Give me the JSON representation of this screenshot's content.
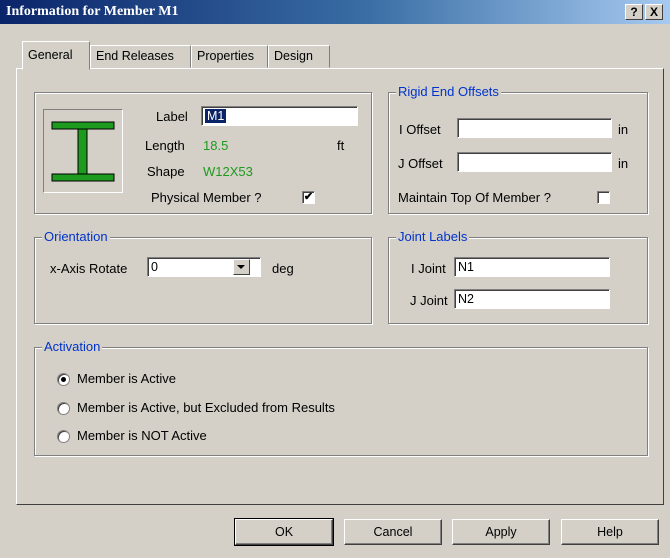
{
  "window": {
    "title": "Information for Member M1",
    "help_btn": "?",
    "close_btn": "X"
  },
  "tabs": [
    "General",
    "End Releases",
    "Properties",
    "Design"
  ],
  "member": {
    "label_caption": "Label",
    "label_value": "M1",
    "length_caption": "Length",
    "length_value": "18.5",
    "length_unit": "ft",
    "shape_caption": "Shape",
    "shape_value": "W12X53",
    "physical_caption": "Physical Member ?"
  },
  "rigid": {
    "title": "Rigid End Offsets",
    "i_caption": "I Offset",
    "i_value": "",
    "i_unit": "in",
    "j_caption": "J Offset",
    "j_value": "",
    "j_unit": "in",
    "maintain_caption": "Maintain Top Of Member ?"
  },
  "orientation": {
    "title": "Orientation",
    "caption": "x-Axis Rotate",
    "value": "0",
    "unit": "deg"
  },
  "joints": {
    "title": "Joint Labels",
    "i_caption": "I Joint",
    "i_value": "N1",
    "j_caption": "J Joint",
    "j_value": "N2"
  },
  "activation": {
    "title": "Activation",
    "options": [
      "Member is Active",
      "Member is Active, but Excluded from Results",
      "Member is NOT Active"
    ]
  },
  "buttons": {
    "ok": "OK",
    "cancel": "Cancel",
    "apply": "Apply",
    "help": "Help"
  },
  "colors": {
    "title_start": "#0a246a",
    "title_end": "#a6caf0",
    "group_title": "#0033cc",
    "value_green": "#1e9a1e",
    "beam_green": "#1e9a1e"
  },
  "icons": {
    "beam": "i-beam-icon",
    "dropdown": "chevron-down-icon"
  }
}
